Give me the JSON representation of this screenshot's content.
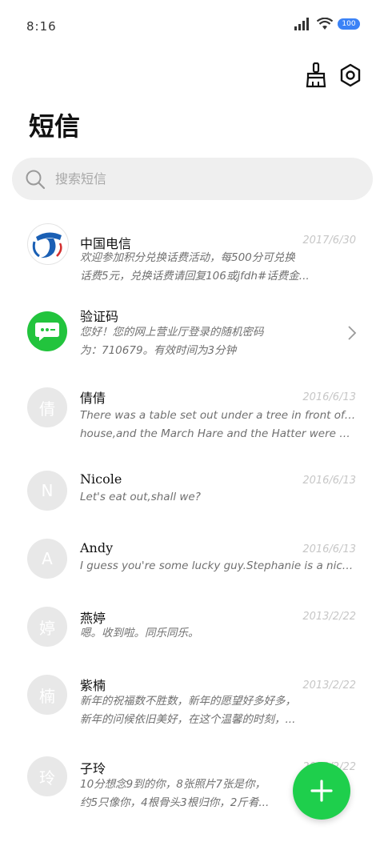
{
  "status_bar": {
    "time": "8:16",
    "battery": "100"
  },
  "header": {
    "title": "短信"
  },
  "search": {
    "placeholder": "搜索短信"
  },
  "threads": [
    {
      "name": "中国电信",
      "date": "2017/6/30",
      "line1": "欢迎参加积分兑换话费活动，每500分可兑换",
      "line2": "话费5元，兑换话费请回复106或jfdh#话费金...",
      "avatar": "telecom-logo"
    },
    {
      "name": "验证码",
      "date": "",
      "line1": "您好！您的网上营业厅登录的随机密码",
      "line2": "为：710679。有效时间为3分钟",
      "avatar": "message-bubble"
    },
    {
      "name": "倩倩",
      "date": "2016/6/13",
      "line1": "There was a table set out under a tree in front of the",
      "line2": "house,and the March Hare and the Hatter were having ...",
      "avatar_text": "倩"
    },
    {
      "name": "Nicole",
      "date": "2016/6/13",
      "line1": "Let's eat out,shall we?",
      "line2": "",
      "avatar_text": "N"
    },
    {
      "name": "Andy",
      "date": "2016/6/13",
      "line1": "I guess you're some lucky guy.Stephanie is a nice girl.",
      "line2": "",
      "avatar_text": "A"
    },
    {
      "name": "燕婷",
      "date": "2013/2/22",
      "line1": "嗯。收到啦。同乐同乐。",
      "line2": "",
      "avatar_text": "婷"
    },
    {
      "name": "紫楠",
      "date": "2013/2/22",
      "line1": "新年的祝福数不胜数，新年的愿望好多好多，",
      "line2": "新年的问候依旧美好，在这个温馨的时刻，...",
      "avatar_text": "楠"
    },
    {
      "name": "子玲",
      "date": "2013/2/22",
      "line1": "10分想念9到的你，8张照片7张是你，",
      "line2": "约5只像你，4根骨头3根归你，2斤肴...",
      "avatar_text": "玲"
    }
  ],
  "colors": {
    "accent": "#1ecf4c",
    "battery": "#3b82f6",
    "search_bg": "#efefef",
    "telecom_blue": "#1a5fb4"
  }
}
